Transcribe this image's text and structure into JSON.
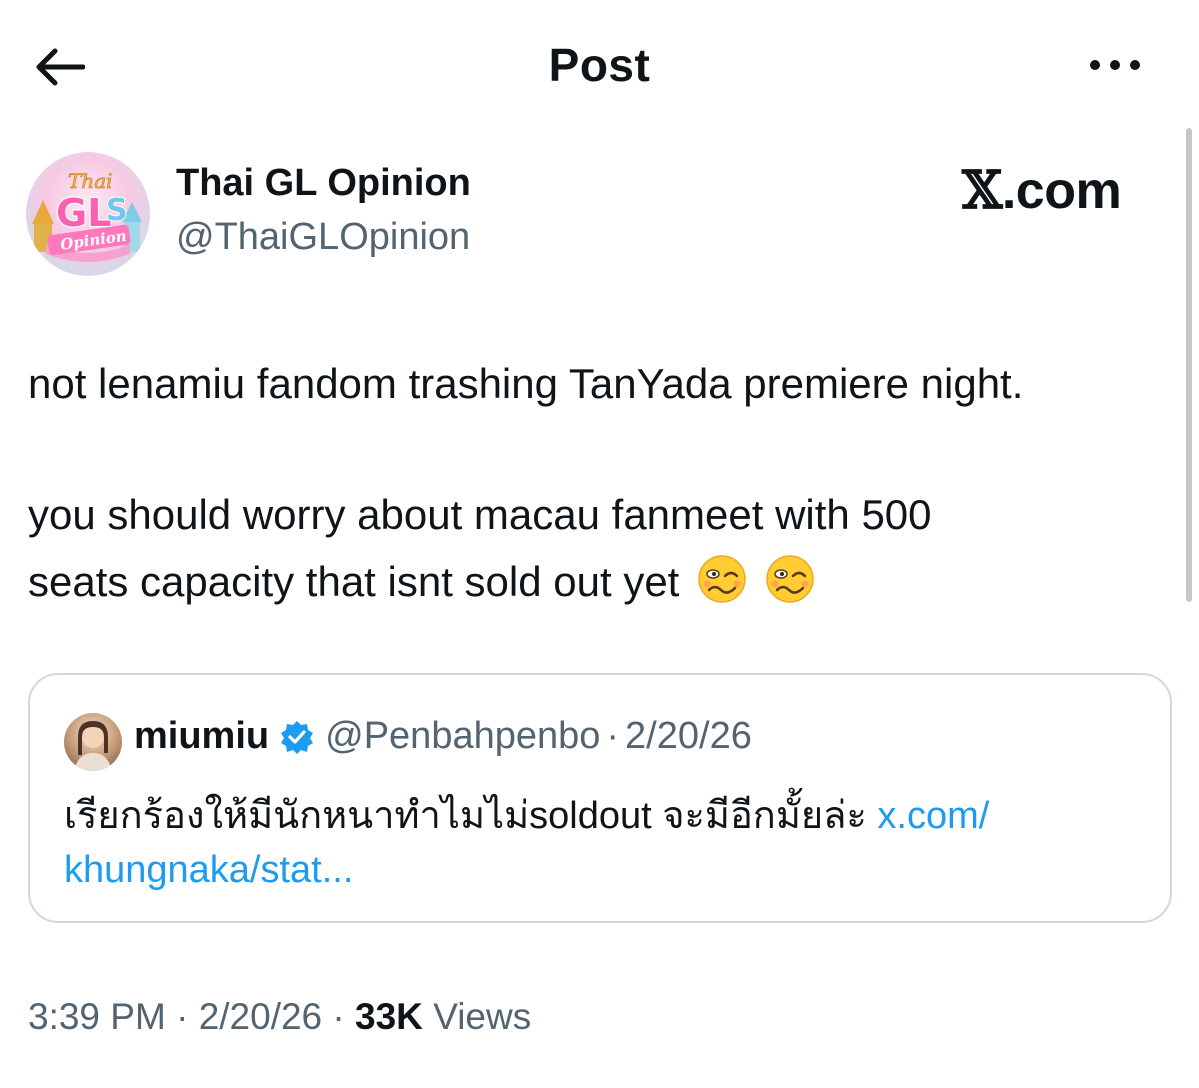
{
  "header": {
    "title": "Post"
  },
  "author": {
    "name": "Thai GL Opinion",
    "handle": "@ThaiGLOpinion",
    "avatar_logo_text": "Thai GL Opinion"
  },
  "watermark": "X.com",
  "tweet": {
    "line1": "not lenamiu fandom trashing TanYada premiere night.",
    "line2": "you should worry about macau fanmeet with 500",
    "line3": "seats capacity  that isnt sold out yet",
    "emojis": [
      "woozy-face-emoji",
      "woozy-face-emoji"
    ]
  },
  "quote": {
    "name": "miumiu",
    "handle": "@Penbahpenbo",
    "separator": "·",
    "date": "2/20/26",
    "text": "เรียกร้องให้มีนักหนาทำไมไม่soldout จะมีอีกมั้ยล่ะ ",
    "link_part1": "x.com/",
    "link_part2": "khungnaka/stat..."
  },
  "meta": {
    "time": "3:39 PM",
    "separator": "·",
    "date": "2/20/26",
    "views_count": "33K",
    "views_label": "Views"
  },
  "colors": {
    "text": "#0f1419",
    "secondary": "#536471",
    "link": "#1d9bf0",
    "border": "#cfd9de",
    "verified": "#1d9bf0"
  }
}
